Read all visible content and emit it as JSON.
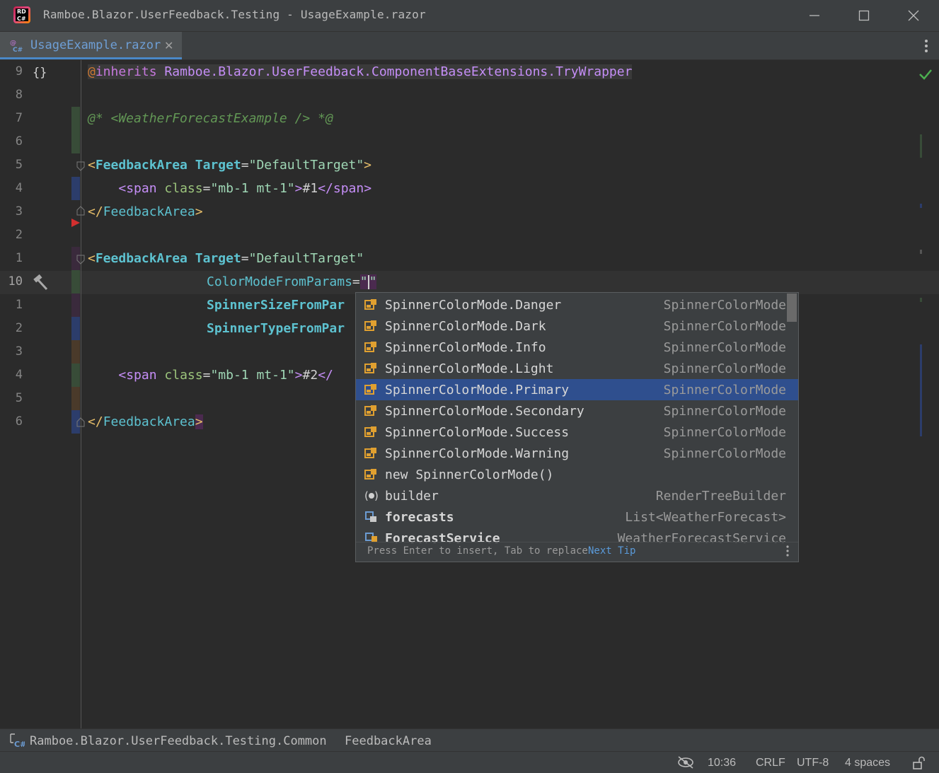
{
  "window": {
    "title": "Ramboe.Blazor.UserFeedback.Testing - UsageExample.razor",
    "logo_text": "RD C#"
  },
  "tabs": [
    {
      "label": "UsageExample.razor",
      "active": true
    }
  ],
  "editor": {
    "line_numbers": [
      "9",
      "8",
      "7",
      "6",
      "5",
      "4",
      "3",
      "2",
      "1",
      "10",
      "1",
      "2",
      "3",
      "4",
      "5",
      "6"
    ],
    "current_line_index": 9,
    "lines": {
      "l0_at": "@",
      "l0_kw": "inherits",
      "l0_ns": "Ramboe.Blazor.UserFeedback.ComponentBaseExtensions.TryWrapper",
      "l2_comment": "@* <WeatherForecastExample /> *@",
      "l4_open": "<",
      "l4_comp": "FeedbackArea",
      "l4_attr": "Target",
      "l4_eq": "=",
      "l4_str": "\"DefaultTarget\"",
      "l4_close": ">",
      "l5_indent": "    ",
      "l5_open": "<",
      "l5_tag": "span",
      "l5_attr": "class",
      "l5_eq": "=",
      "l5_str": "\"mb-1 mt-1\"",
      "l5_gt": ">",
      "l5_text": "#1",
      "l5_close_open": "</",
      "l5_close_tag": "span",
      "l5_close_gt": ">",
      "l6_open": "</",
      "l6_comp": "FeedbackArea",
      "l6_close": ">",
      "l8_open": "<",
      "l8_comp": "FeedbackArea",
      "l8_attr": "Target",
      "l8_eq": "=",
      "l8_str": "\"DefaultTarget\"",
      "l9_attr": "ColorModeFromParams",
      "l9_eq": "=",
      "l9_q1": "\"",
      "l9_q2": "\"",
      "l10_attr": "SpinnerSizeFromPar",
      "l11_attr": "SpinnerTypeFromPar",
      "l13_indent": "    ",
      "l13_open": "<",
      "l13_tag": "span",
      "l13_attr": "class",
      "l13_eq": "=",
      "l13_str": "\"mb-1 mt-1\"",
      "l13_gt": ">",
      "l13_text": "#2",
      "l13_close_open": "</",
      "l15_open": "</",
      "l15_comp": "FeedbackArea",
      "l15_close": ">"
    }
  },
  "completion": {
    "items": [
      {
        "label": "SpinnerColorMode.Danger",
        "type": "SpinnerColorMode",
        "icon": "enum-member-icon"
      },
      {
        "label": "SpinnerColorMode.Dark",
        "type": "SpinnerColorMode",
        "icon": "enum-member-icon"
      },
      {
        "label": "SpinnerColorMode.Info",
        "type": "SpinnerColorMode",
        "icon": "enum-member-icon"
      },
      {
        "label": "SpinnerColorMode.Light",
        "type": "SpinnerColorMode",
        "icon": "enum-member-icon"
      },
      {
        "label": "SpinnerColorMode.Primary",
        "type": "SpinnerColorMode",
        "icon": "enum-member-icon",
        "selected": true
      },
      {
        "label": "SpinnerColorMode.Secondary",
        "type": "SpinnerColorMode",
        "icon": "enum-member-icon"
      },
      {
        "label": "SpinnerColorMode.Success",
        "type": "SpinnerColorMode",
        "icon": "enum-member-icon"
      },
      {
        "label": "SpinnerColorMode.Warning",
        "type": "SpinnerColorMode",
        "icon": "enum-member-icon"
      },
      {
        "label": "new SpinnerColorMode()",
        "type": "",
        "icon": "enum-member-icon"
      },
      {
        "label": "builder",
        "type": "RenderTreeBuilder",
        "icon": "parameter-icon"
      },
      {
        "label": "forecasts",
        "type": "List<WeatherForecast>",
        "icon": "field-icon",
        "bold": true
      },
      {
        "label": "ForecastService",
        "type": "WeatherForecastService",
        "icon": "property-icon",
        "bold": true
      }
    ],
    "footer_text": "Press Enter to insert, Tab to replace",
    "footer_link": "Next Tip"
  },
  "breadcrumb": {
    "namespace": "Ramboe.Blazor.UserFeedback.Testing.Common",
    "component": "FeedbackArea"
  },
  "status": {
    "position": "10:36",
    "line_ending": "CRLF",
    "encoding": "UTF-8",
    "indent": "4 spaces"
  },
  "colors": {
    "accent": "#4a88c7",
    "selection": "#2f4f8e",
    "background": "#2b2b2b"
  }
}
